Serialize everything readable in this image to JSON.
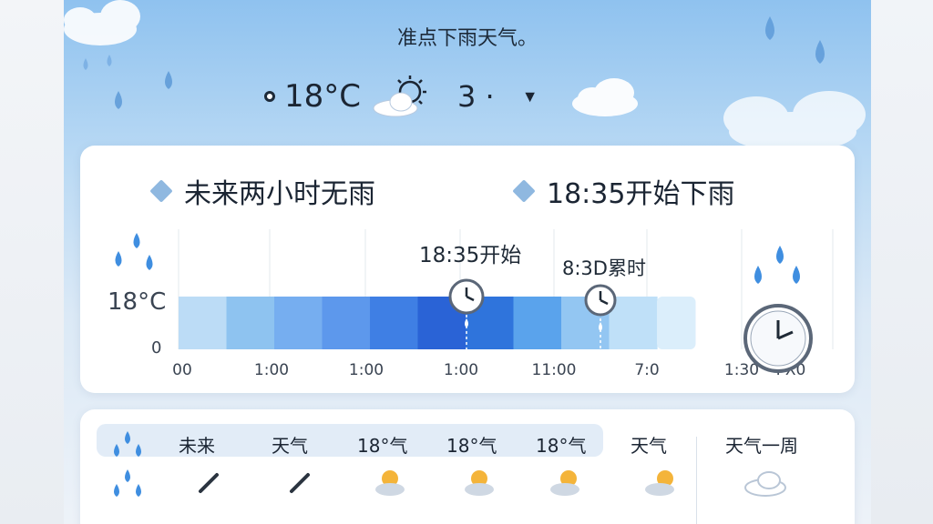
{
  "header": {
    "title": "准点下雨天气。"
  },
  "current": {
    "temperature": "18°C",
    "count": "3 ·",
    "caret": "▼"
  },
  "status": {
    "left": "未来两小时无雨",
    "right": "18:35开始下雨"
  },
  "chart_data": {
    "type": "area",
    "y_tick_labels": [
      "18°C",
      "0"
    ],
    "x_tick_labels": [
      "00",
      "1:00",
      "1:00",
      "1:00",
      "11:00",
      "7:0",
      "1:30",
      "PX0"
    ],
    "annotations": [
      "18:35开始",
      "8:3D累时"
    ],
    "bands": [
      {
        "color": "#bcdcf6"
      },
      {
        "color": "#8ec3f0"
      },
      {
        "color": "#76aef0"
      },
      {
        "color": "#5d98ec"
      },
      {
        "color": "#3f7fe4"
      },
      {
        "color": "#2a63d6"
      },
      {
        "color": "#2f74dc"
      },
      {
        "color": "#5aa3ec"
      },
      {
        "color": "#93c6f2"
      },
      {
        "color": "#bfe0f8"
      },
      {
        "color": "#dbeefb"
      }
    ],
    "colors": {
      "grid": "#e3e8ee",
      "axis_text": "#3a4452"
    }
  },
  "table": {
    "headers": [
      "未来",
      "天气",
      "18°气",
      "18°气",
      "18°气",
      "天气",
      "天气一周"
    ]
  }
}
